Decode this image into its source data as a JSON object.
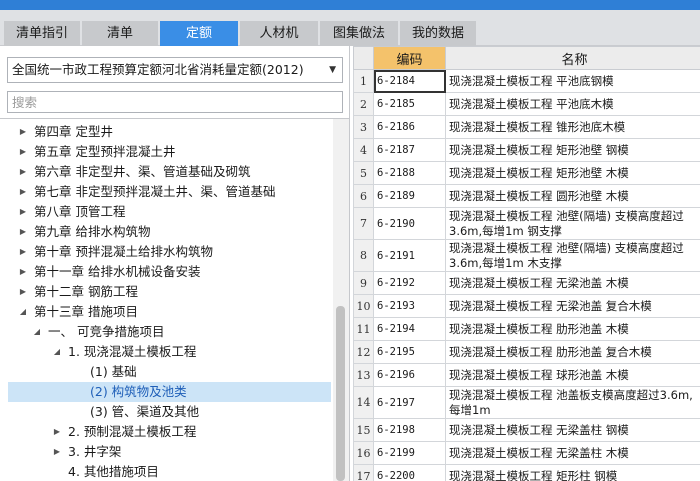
{
  "tabs": [
    {
      "label": "清单指引",
      "active": false
    },
    {
      "label": "清单",
      "active": false
    },
    {
      "label": "定额",
      "active": true
    },
    {
      "label": "人材机",
      "active": false
    },
    {
      "label": "图集做法",
      "active": false
    },
    {
      "label": "我的数据",
      "active": false
    }
  ],
  "quota_select": {
    "value": "全国统一市政工程预算定额河北省消耗量定额(2012)"
  },
  "search": {
    "placeholder": "搜索"
  },
  "tree": [
    {
      "label": "第四章 定型井",
      "toggle": "▶",
      "level": 0
    },
    {
      "label": "第五章 定型预拌混凝土井",
      "toggle": "▶",
      "level": 0
    },
    {
      "label": "第六章 非定型井、渠、管道基础及砌筑",
      "toggle": "▶",
      "level": 0
    },
    {
      "label": "第七章 非定型预拌混凝土井、渠、管道基础",
      "toggle": "▶",
      "level": 0
    },
    {
      "label": "第八章 顶管工程",
      "toggle": "▶",
      "level": 0
    },
    {
      "label": "第九章 给排水构筑物",
      "toggle": "▶",
      "level": 0
    },
    {
      "label": "第十章 预拌混凝土给排水构筑物",
      "toggle": "▶",
      "level": 0
    },
    {
      "label": "第十一章 给排水机械设备安装",
      "toggle": "▶",
      "level": 0
    },
    {
      "label": "第十二章 钢筋工程",
      "toggle": "▶",
      "level": 0
    },
    {
      "label": "第十三章 措施项目",
      "toggle": "◢",
      "level": 0
    },
    {
      "label": "一、 可竞争措施项目",
      "toggle": "◢",
      "level": 1
    },
    {
      "label": "1. 现浇混凝土模板工程",
      "toggle": "◢",
      "level": 2
    },
    {
      "label": "(1) 基础",
      "toggle": "",
      "level": 3
    },
    {
      "label": "(2) 构筑物及池类",
      "toggle": "",
      "level": 3,
      "selected": true
    },
    {
      "label": "(3) 管、渠道及其他",
      "toggle": "",
      "level": 3
    },
    {
      "label": "2. 预制混凝土模板工程",
      "toggle": "▶",
      "level": 2
    },
    {
      "label": "3. 井字架",
      "toggle": "▶",
      "level": 2
    },
    {
      "label": "4. 其他措施项目",
      "toggle": "",
      "level": 2
    }
  ],
  "grid": {
    "headers": {
      "rownum": "",
      "code": "编码",
      "name": "名称"
    },
    "rows": [
      {
        "num": "1",
        "code": "6-2184",
        "name": "现浇混凝土模板工程 平池底钢模",
        "selected": true
      },
      {
        "num": "2",
        "code": "6-2185",
        "name": "现浇混凝土模板工程 平池底木模"
      },
      {
        "num": "3",
        "code": "6-2186",
        "name": "现浇混凝土模板工程 锥形池底木模"
      },
      {
        "num": "4",
        "code": "6-2187",
        "name": "现浇混凝土模板工程 矩形池壁 钢模"
      },
      {
        "num": "5",
        "code": "6-2188",
        "name": "现浇混凝土模板工程 矩形池壁 木模"
      },
      {
        "num": "6",
        "code": "6-2189",
        "name": "现浇混凝土模板工程 圆形池壁 木模"
      },
      {
        "num": "7",
        "code": "6-2190",
        "name": "现浇混凝土模板工程 池壁(隔墙) 支模高度超过3.6m,每增1m 钢支撑",
        "tall": true
      },
      {
        "num": "8",
        "code": "6-2191",
        "name": "现浇混凝土模板工程 池壁(隔墙) 支模高度超过3.6m,每增1m 木支撑",
        "tall": true
      },
      {
        "num": "9",
        "code": "6-2192",
        "name": "现浇混凝土模板工程 无梁池盖 木模"
      },
      {
        "num": "10",
        "code": "6-2193",
        "name": "现浇混凝土模板工程 无梁池盖 复合木模"
      },
      {
        "num": "11",
        "code": "6-2194",
        "name": "现浇混凝土模板工程 肋形池盖 木模"
      },
      {
        "num": "12",
        "code": "6-2195",
        "name": "现浇混凝土模板工程 肋形池盖 复合木模"
      },
      {
        "num": "13",
        "code": "6-2196",
        "name": "现浇混凝土模板工程 球形池盖 木模"
      },
      {
        "num": "14",
        "code": "6-2197",
        "name": "现浇混凝土模板工程 池盖板支模高度超过3.6m,每增1m",
        "tall": true
      },
      {
        "num": "15",
        "code": "6-2198",
        "name": "现浇混凝土模板工程 无梁盖柱 钢模"
      },
      {
        "num": "16",
        "code": "6-2199",
        "name": "现浇混凝土模板工程 无梁盖柱 木模"
      },
      {
        "num": "17",
        "code": "6-2200",
        "name": "现浇混凝土模板工程 矩形柱 钢模"
      }
    ]
  }
}
